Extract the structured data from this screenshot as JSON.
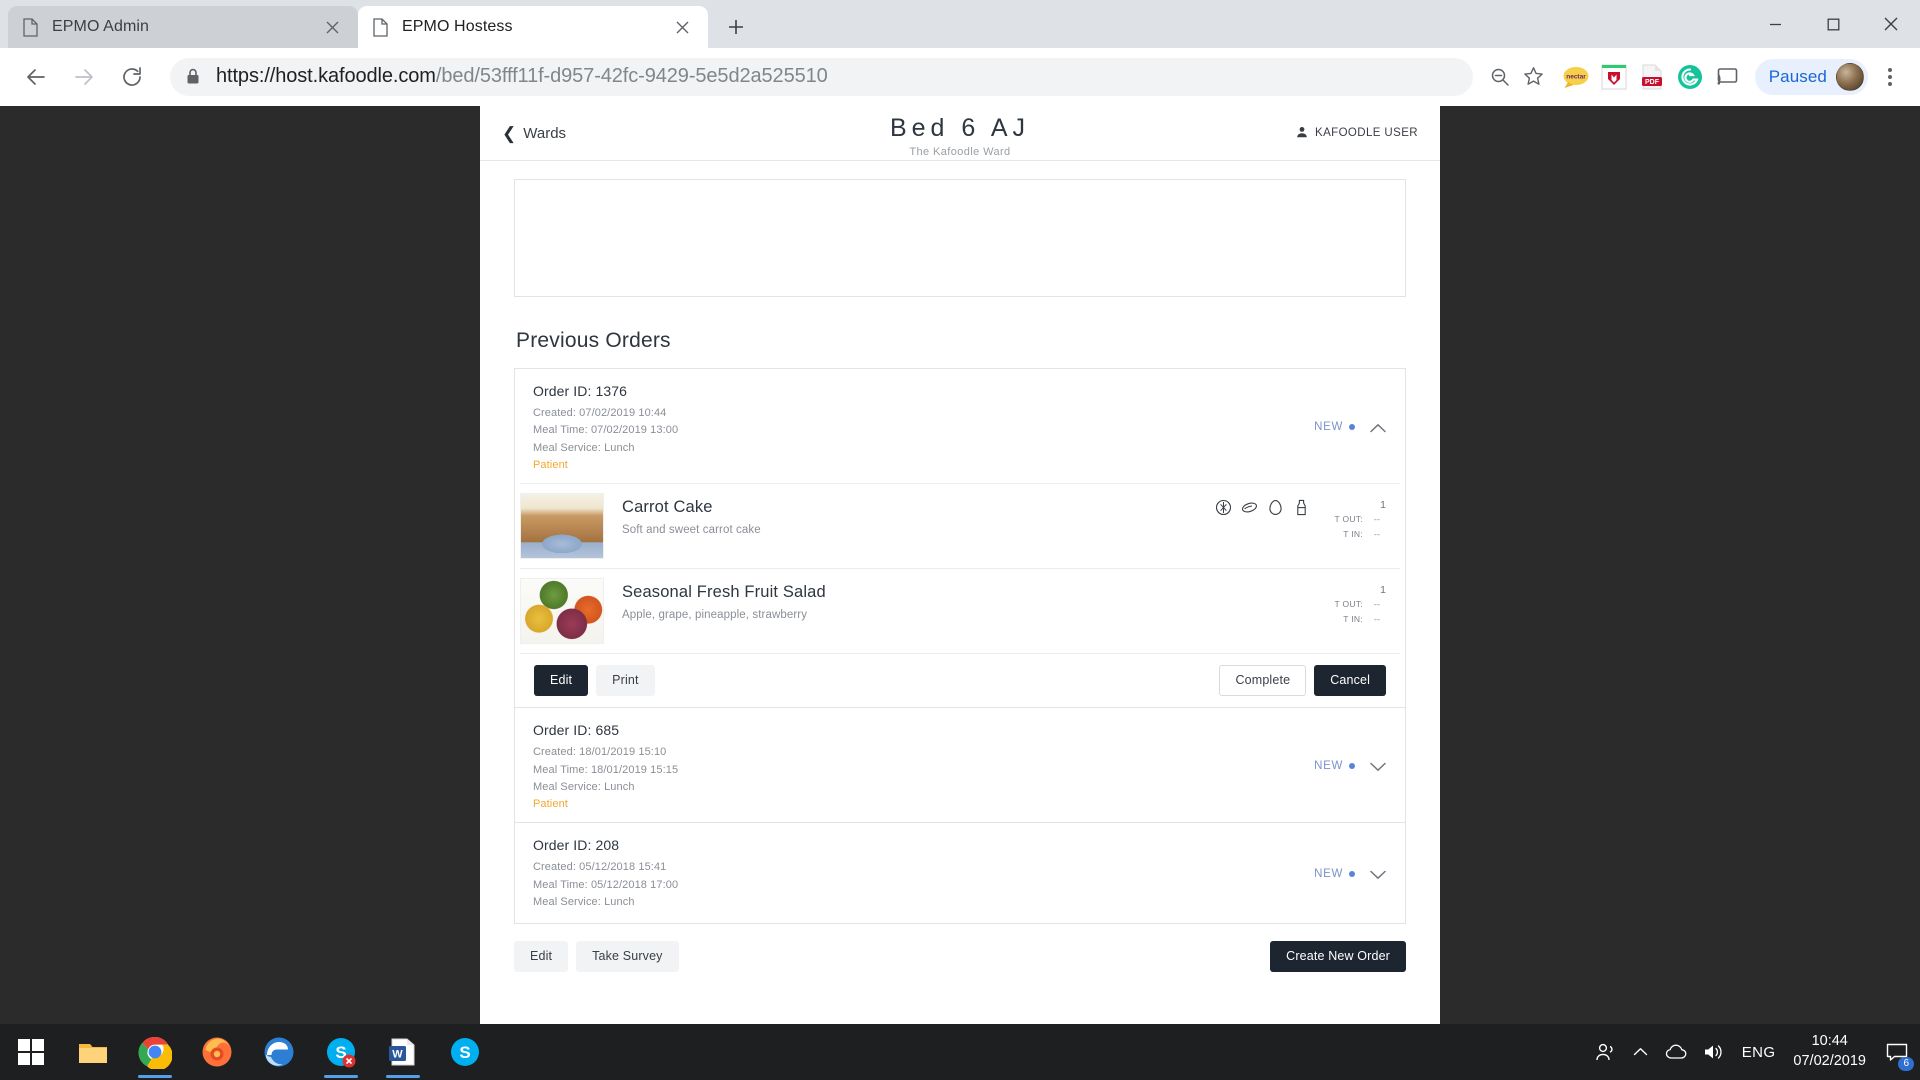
{
  "browser": {
    "tabs": [
      {
        "title": "EPMO Admin",
        "active": false,
        "favicon": "page-icon"
      },
      {
        "title": "EPMO Hostess",
        "active": true,
        "favicon": "page-icon"
      }
    ],
    "new_tab_label": "+",
    "window_controls": {
      "minimize": "minimize-icon",
      "maximize": "maximize-icon",
      "close": "close-icon"
    },
    "nav": {
      "back": "back-arrow-icon",
      "forward": "forward-arrow-icon",
      "reload": "reload-icon"
    },
    "omnibox": {
      "lock": "lock-icon",
      "url_prefix": "https://host.kafoodle.com",
      "url_path": "/bed/53fff11f-d957-42fc-9429-5e5d2a525510",
      "full_url": "https://host.kafoodle.com/bed/53fff11f-d957-42fc-9429-5e5d2a525510",
      "zoom_icon": "zoom-out-icon",
      "bookmark_icon": "star-icon"
    },
    "extensions": [
      {
        "name": "nectar-extension-icon",
        "label": "nectar"
      },
      {
        "name": "mcafee-extension-icon",
        "label": ""
      },
      {
        "name": "adobe-acrobat-extension-icon",
        "label": ""
      },
      {
        "name": "grammarly-extension-icon",
        "label": "G"
      },
      {
        "name": "cast-icon",
        "label": ""
      }
    ],
    "profile": {
      "label": "Paused",
      "avatar": "user-avatar"
    },
    "menu": "three-dot-menu-icon"
  },
  "app": {
    "header": {
      "back_label": "Wards",
      "title": "Bed 6 AJ",
      "subtitle": "The Kafoodle Ward",
      "user_label": "KAFOODLE USER",
      "user_icon": "person-icon"
    },
    "section_title": "Previous Orders",
    "orders": [
      {
        "order_id_label": "Order ID: 1376",
        "created": "Created: 07/02/2019 10:44",
        "meal_time": "Meal Time: 07/02/2019 13:00",
        "meal_service": "Meal Service: Lunch",
        "tag": "Patient",
        "status": "NEW",
        "expanded": true,
        "chevron": "chevron-up-icon",
        "items": [
          {
            "name": "Carrot Cake",
            "description": "Soft and sweet carrot cake",
            "thumb": "carrot-cake-photo",
            "quantity": "1",
            "temp_out_label": "T OUT:",
            "temp_out_value": "--",
            "temp_in_label": "T IN:",
            "temp_in_value": "--",
            "allergens": [
              "gluten-allergen-icon",
              "nuts-allergen-icon",
              "egg-allergen-icon",
              "milk-allergen-icon"
            ]
          },
          {
            "name": "Seasonal Fresh Fruit Salad",
            "description": "Apple, grape, pineapple, strawberry",
            "thumb": "fruit-salad-photo",
            "quantity": "1",
            "temp_out_label": "T OUT:",
            "temp_out_value": "--",
            "temp_in_label": "T IN:",
            "temp_in_value": "--",
            "allergens": []
          }
        ],
        "actions": {
          "edit": "Edit",
          "print": "Print",
          "complete": "Complete",
          "cancel": "Cancel"
        }
      },
      {
        "order_id_label": "Order ID: 685",
        "created": "Created: 18/01/2019 15:10",
        "meal_time": "Meal Time: 18/01/2019 15:15",
        "meal_service": "Meal Service: Lunch",
        "tag": "Patient",
        "status": "NEW",
        "expanded": false,
        "chevron": "chevron-down-icon"
      },
      {
        "order_id_label": "Order ID: 208",
        "created": "Created: 05/12/2018 15:41",
        "meal_time": "Meal Time: 05/12/2018 17:00",
        "meal_service": "Meal Service: Lunch",
        "tag": "",
        "status": "NEW",
        "expanded": false,
        "chevron": "chevron-down-icon"
      }
    ],
    "footer": {
      "edit": "Edit",
      "take_survey": "Take Survey",
      "create_new_order": "Create New Order"
    }
  },
  "taskbar": {
    "start": "windows-start-icon",
    "items": [
      {
        "name": "file-explorer-icon",
        "running": false
      },
      {
        "name": "google-chrome-icon",
        "running": true
      },
      {
        "name": "mozilla-firefox-icon",
        "running": false
      },
      {
        "name": "microsoft-edge-icon",
        "running": false
      },
      {
        "name": "skype-classic-icon",
        "running": true
      },
      {
        "name": "microsoft-word-icon",
        "running": true
      },
      {
        "name": "skype-icon",
        "running": false
      }
    ],
    "tray": {
      "people_icon": "people-icon",
      "chevron_icon": "show-hidden-icons-icon",
      "onedrive_icon": "onedrive-cloud-icon",
      "volume_icon": "volume-icon",
      "language": "ENG",
      "time": "10:44",
      "date": "07/02/2019",
      "notification_icon": "action-center-icon",
      "notification_count": "6"
    }
  },
  "colors": {
    "accent_dark": "#1d2530",
    "status_blue": "#5b82d6",
    "tag_orange": "#f0a830",
    "chrome_tabstrip": "#dee1e6",
    "profile_chip": "#e8f0fe",
    "profile_text": "#1967d2",
    "taskbar": "#1d1f21"
  }
}
